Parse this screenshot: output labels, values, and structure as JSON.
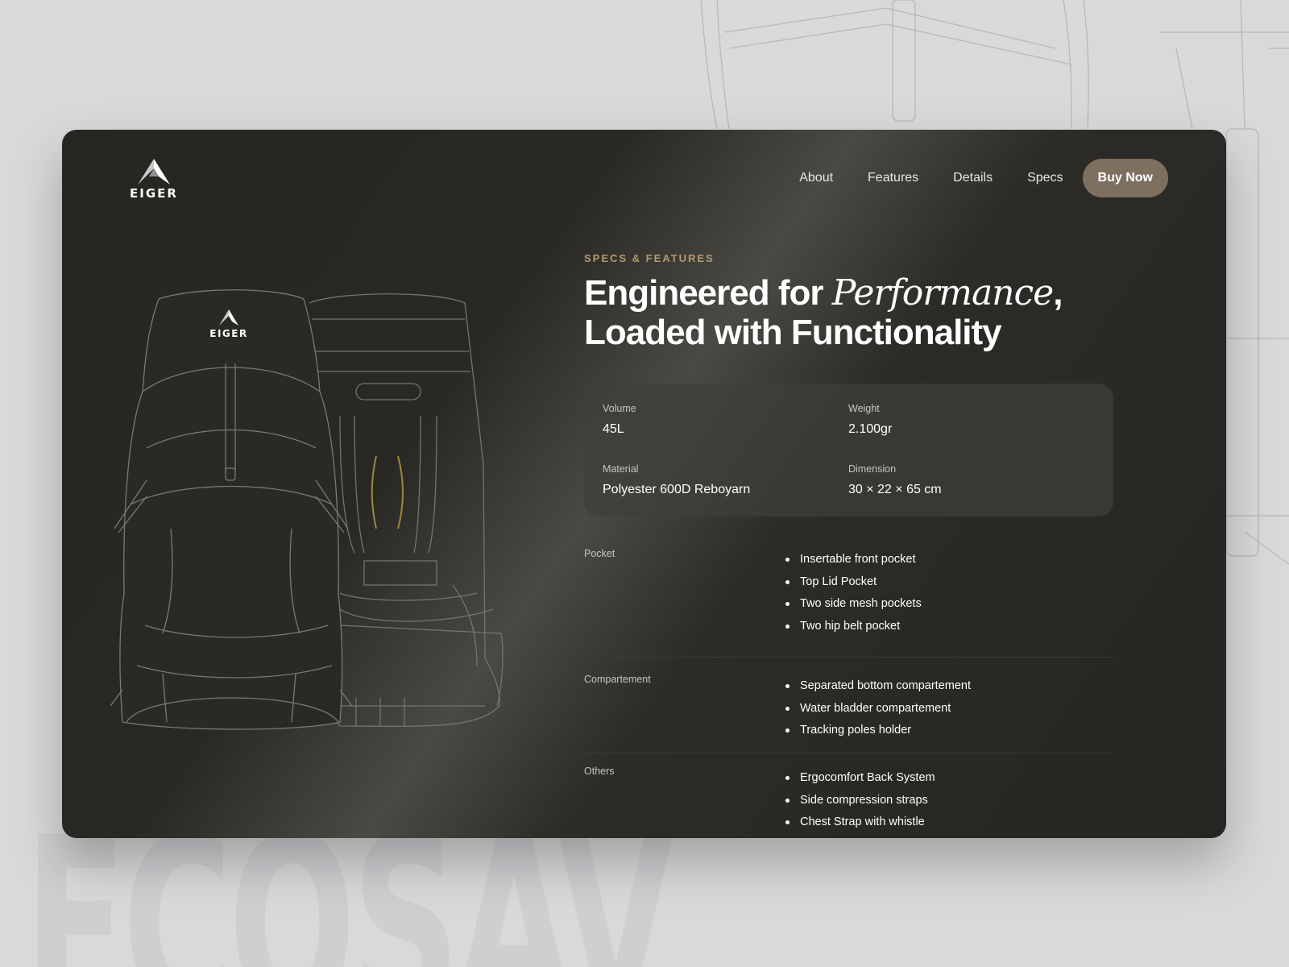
{
  "brand": {
    "logo_text": "EIGER",
    "bag_logo_text": "EIGER"
  },
  "nav": {
    "items": [
      "About",
      "Features",
      "Details",
      "Specs"
    ],
    "cta": "Buy Now"
  },
  "hero": {
    "eyebrow": "SPECS & FEATURES",
    "headline_part1": "Engineered for ",
    "headline_italic": "Performance",
    "headline_part2": ",",
    "headline_line2": "Loaded with Functionality"
  },
  "specs": [
    {
      "label": "Volume",
      "value": "45L"
    },
    {
      "label": "Weight",
      "value": "2.100gr"
    },
    {
      "label": "Material",
      "value": "Polyester 600D Reboyarn"
    },
    {
      "label": "Dimension",
      "value": "30 × 22 × 65 cm"
    }
  ],
  "features": [
    {
      "label": "Pocket",
      "items": [
        "Insertable front pocket",
        "Top Lid Pocket",
        "Two side mesh pockets",
        "Two hip belt pocket"
      ]
    },
    {
      "label": "Compartement",
      "items": [
        "Separated bottom compartement",
        "Water bladder compartement",
        "Tracking poles holder"
      ]
    },
    {
      "label": "Others",
      "items": [
        "Ergocomfort Back System",
        "Side compression straps",
        "Chest Strap with whistle"
      ]
    }
  ],
  "background": {
    "word": "ECOSAVIOR"
  },
  "colors": {
    "accent": "#7d7061",
    "eyebrow": "#b39974",
    "panel": "#272622"
  },
  "icons": {
    "logo": "mountain-peak-icon"
  }
}
